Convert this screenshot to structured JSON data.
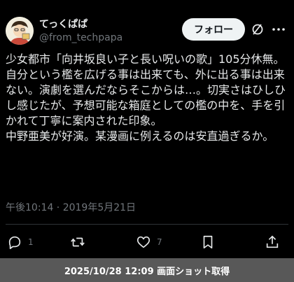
{
  "author": {
    "display_name": "てっくぱぱ",
    "handle": "@from_techpapa"
  },
  "follow_label": "フォロー",
  "tweet": {
    "text": "少女都市「向井坂良い子と長い呪いの歌」105分休無。\n自分という檻を広げる事は出来ても、外に出る事は出来ない。演劇を選んだならそこからは…。切実さはひしひし感じたが、予想可能な箱庭としての檻の中を、手を引かれて丁寧に案内された印象。\n中野亜美が好演。某漫画に例えるのは安直過ぎるか。",
    "timestamp": "午後10:14 · 2019年5月21日"
  },
  "actions": {
    "reply_count": "1",
    "retweet_count": "",
    "like_count": "7"
  },
  "footer": {
    "caption": "2025/10/28 12:09 画面ショット取得"
  },
  "icons": {
    "reply": "reply-icon",
    "retweet": "retweet-icon",
    "like": "heart-icon",
    "bookmark": "bookmark-icon",
    "share": "share-icon",
    "grok": "grok-icon",
    "more": "more-icon"
  }
}
